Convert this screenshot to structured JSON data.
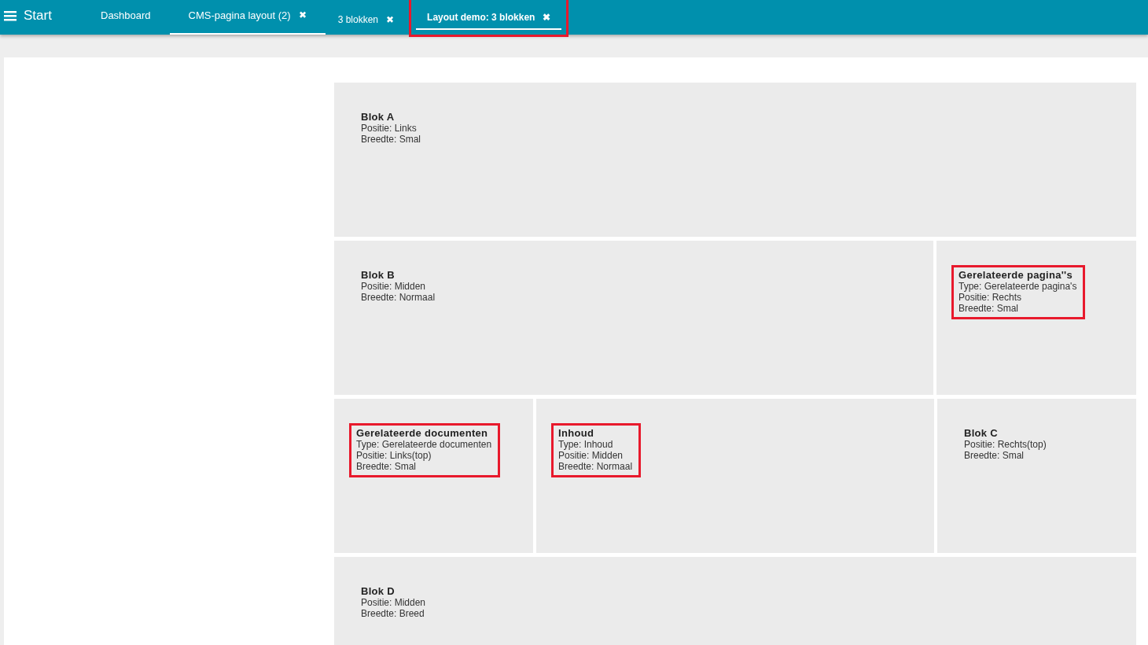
{
  "topbar": {
    "menu_label": "Start"
  },
  "tabs": [
    {
      "label": "Dashboard",
      "kind": "main",
      "selected": false,
      "closable": false,
      "highlighted": false
    },
    {
      "label": "CMS-pagina layout (2)",
      "kind": "main",
      "selected": true,
      "closable": true,
      "highlighted": false
    },
    {
      "label": "3 blokken",
      "kind": "sub",
      "selected": false,
      "closable": true,
      "highlighted": false
    },
    {
      "label": "Layout demo: 3 blokken",
      "kind": "sub",
      "selected": true,
      "closable": true,
      "highlighted": true
    }
  ],
  "close_glyph": "✖",
  "rows": [
    {
      "blocks": [
        {
          "title": "Blok A",
          "lines": [
            "Positie: Links",
            "Breedte: Smal"
          ],
          "highlighted": false
        }
      ]
    },
    {
      "blocks": [
        {
          "title": "Blok B",
          "lines": [
            "Positie: Midden",
            "Breedte: Normaal"
          ],
          "highlighted": false
        },
        {
          "title": "Gerelateerde pagina''s",
          "lines": [
            "Type: Gerelateerde pagina's",
            "Positie: Rechts",
            "Breedte: Smal"
          ],
          "highlighted": true
        }
      ]
    },
    {
      "blocks": [
        {
          "title": "Gerelateerde documenten",
          "lines": [
            "Type: Gerelateerde documenten",
            "Positie: Links(top)",
            "Breedte: Smal"
          ],
          "highlighted": true
        },
        {
          "title": "Inhoud",
          "lines": [
            "Type: Inhoud",
            "Positie: Midden",
            "Breedte: Normaal"
          ],
          "highlighted": true
        },
        {
          "title": "Blok C",
          "lines": [
            "Positie: Rechts(top)",
            "Breedte: Smal"
          ],
          "highlighted": false
        }
      ]
    },
    {
      "blocks": [
        {
          "title": "Blok D",
          "lines": [
            "Positie: Midden",
            "Breedte: Breed"
          ],
          "highlighted": false
        }
      ]
    }
  ]
}
